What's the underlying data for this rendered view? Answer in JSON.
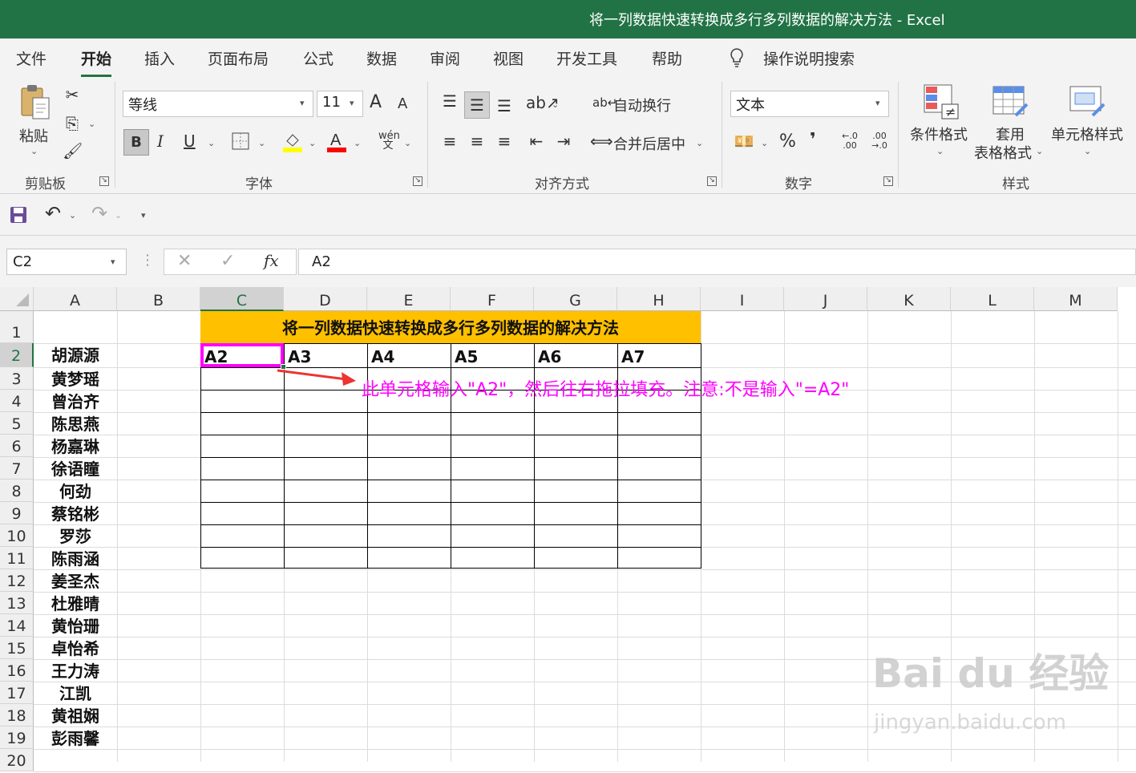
{
  "window": {
    "title": "将一列数据快速转换成多行多列数据的解决方法  -  Excel"
  },
  "tabs": [
    "文件",
    "开始",
    "插入",
    "页面布局",
    "公式",
    "数据",
    "审阅",
    "视图",
    "开发工具",
    "帮助"
  ],
  "active_tab": "开始",
  "tell_me": "操作说明搜索",
  "clipboard": {
    "paste": "粘贴",
    "group": "剪贴板"
  },
  "font": {
    "name": "等线",
    "size": "11",
    "group": "字体",
    "bold": "B",
    "italic": "I",
    "underline": "U",
    "grow": "A",
    "shrink": "A",
    "fill_color": "#ffff00",
    "font_color": "#ff0000"
  },
  "alignment": {
    "wrap": "自动换行",
    "merge": "合并后居中",
    "group": "对齐方式"
  },
  "number": {
    "format": "文本",
    "percent": "%",
    "comma": "❜",
    "group": "数字",
    "inc_decimal": "←.0 .00",
    "dec_decimal": ".00 →.0"
  },
  "styles": {
    "conditional": "条件格式",
    "table_1": "套用",
    "table_2": "表格格式",
    "cell": "单元格样式",
    "group": "样式"
  },
  "formula_bar": {
    "name_box": "C2",
    "fx": "fx",
    "value": "A2"
  },
  "columns": [
    "A",
    "B",
    "C",
    "D",
    "E",
    "F",
    "G",
    "H",
    "I",
    "J",
    "K",
    "L",
    "M"
  ],
  "selected_column": "C",
  "rows": [
    "1",
    "2",
    "3",
    "4",
    "5",
    "6",
    "7",
    "8",
    "9",
    "10",
    "11",
    "12",
    "13",
    "14",
    "15",
    "16",
    "17",
    "18",
    "19",
    "20"
  ],
  "selected_row": "2",
  "sheet_title": "将一列数据快速转换成多行多列数据的解决方法",
  "title_fill": "#ffc000",
  "header_row": [
    "A2",
    "A3",
    "A4",
    "A5",
    "A6",
    "A7"
  ],
  "names": [
    "胡源源",
    "黄梦瑶",
    "曾治齐",
    "陈思燕",
    "杨嘉琳",
    "徐语瞳",
    "何劲",
    "蔡铭彬",
    "罗莎",
    "陈雨涵",
    "姜圣杰",
    "杜雅晴",
    "黄怡珊",
    "卓怡希",
    "王力涛",
    "江凯",
    "黄祖娴",
    "彭雨馨"
  ],
  "annotation": "此单元格输入\"A2\"，然后往右拖拉填充。注意:不是输入\"=A2\"",
  "annotation_color": "#ff00ff",
  "watermark": {
    "brand": "Bai du 经验",
    "url": "jingyan.baidu.com"
  }
}
